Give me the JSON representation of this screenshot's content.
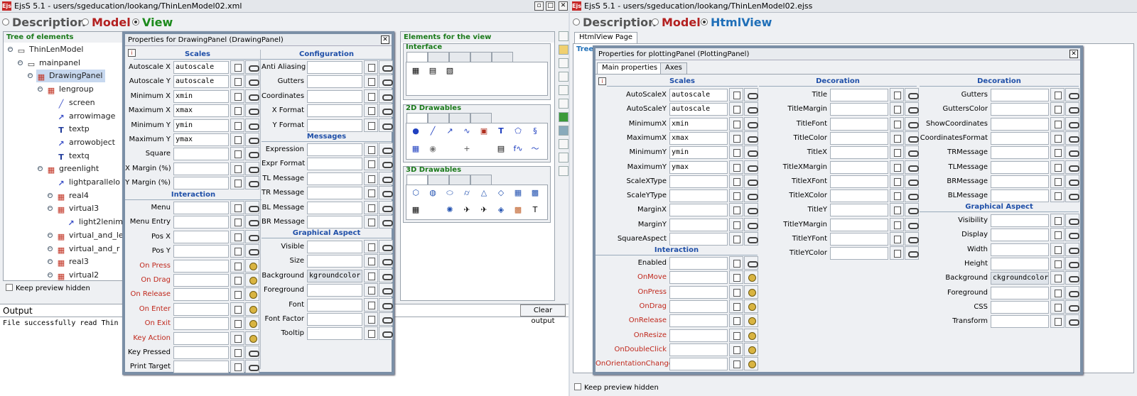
{
  "left_window": {
    "title": "EjsS 5.1 - users/sgeducation/lookang/ThinLenModel02.xml",
    "modes": [
      {
        "label": "Description",
        "color": "#555555",
        "selected": false
      },
      {
        "label": "Model",
        "color": "#b32020",
        "selected": false
      },
      {
        "label": "View",
        "color": "#1c8a1c",
        "selected": true
      }
    ],
    "tree_title": "Tree of elements",
    "tree": [
      {
        "label": "ThinLenModel",
        "icon": "frame"
      },
      {
        "label": "mainpanel",
        "icon": "panel"
      },
      {
        "label": "DrawingPanel",
        "icon": "chart",
        "selected": true
      },
      {
        "label": "lengroup",
        "icon": "chart"
      },
      {
        "label": "screen",
        "icon": "line"
      },
      {
        "label": "arrowimage",
        "icon": "arrow"
      },
      {
        "label": "textp",
        "icon": "text"
      },
      {
        "label": "arrowobject",
        "icon": "arrow"
      },
      {
        "label": "textq",
        "icon": "text"
      },
      {
        "label": "greenlight",
        "icon": "chart"
      },
      {
        "label": "lightparallelo",
        "icon": "arrow"
      },
      {
        "label": "real4",
        "icon": "chart"
      },
      {
        "label": "virtual3",
        "icon": "chart"
      },
      {
        "label": "light2lenim",
        "icon": "arrow"
      },
      {
        "label": "virtual_and_le",
        "icon": "chart"
      },
      {
        "label": "virtual_and_r",
        "icon": "chart"
      },
      {
        "label": "real3",
        "icon": "chart"
      },
      {
        "label": "virtual2",
        "icon": "chart"
      }
    ],
    "keep_preview": "Keep preview hidden",
    "output_title": "Output",
    "clear_output": "Clear output",
    "output_text": "File successfully read Thin",
    "elements_title": "Elements for the view",
    "interface_label": "Interface",
    "d2_label": "2D Drawables",
    "d3_label": "3D Drawables"
  },
  "drawing_dialog": {
    "title": "Properties for DrawingPanel (DrawingPanel)",
    "sections": {
      "scales": "Scales",
      "configuration": "Configuration",
      "interaction": "Interaction",
      "messages": "Messages",
      "graphical": "Graphical Aspect"
    },
    "left_rows": [
      {
        "label": "Autoscale X",
        "value": "autoscale",
        "red": false
      },
      {
        "label": "Autoscale Y",
        "value": "autoscale",
        "red": false
      },
      {
        "label": "Minimum X",
        "value": "xmin",
        "red": false
      },
      {
        "label": "Maximum X",
        "value": "xmax",
        "red": false
      },
      {
        "label": "Minimum Y",
        "value": "ymin",
        "red": false
      },
      {
        "label": "Maximum Y",
        "value": "ymax",
        "red": false
      },
      {
        "label": "Square",
        "value": "",
        "red": false
      },
      {
        "label": "X Margin (%)",
        "value": "",
        "red": false
      },
      {
        "label": "Y Margin (%)",
        "value": "",
        "red": false
      }
    ],
    "interaction_rows": [
      {
        "label": "Menu",
        "value": "",
        "red": false
      },
      {
        "label": "Menu Entry",
        "value": "",
        "red": false
      },
      {
        "label": "Pos X",
        "value": "",
        "red": false
      },
      {
        "label": "Pos Y",
        "value": "",
        "red": false
      },
      {
        "label": "On Press",
        "value": "",
        "red": true
      },
      {
        "label": "On Drag",
        "value": "",
        "red": true
      },
      {
        "label": "On Release",
        "value": "",
        "red": true
      },
      {
        "label": "On Enter",
        "value": "",
        "red": true
      },
      {
        "label": "On Exit",
        "value": "",
        "red": true
      },
      {
        "label": "Key Action",
        "value": "",
        "red": true
      },
      {
        "label": "Key Pressed",
        "value": "",
        "red": false
      },
      {
        "label": "Print Target",
        "value": "",
        "red": false
      }
    ],
    "config_rows": [
      {
        "label": "Anti Aliasing",
        "value": ""
      },
      {
        "label": "Gutters",
        "value": ""
      },
      {
        "label": "Coordinates",
        "value": ""
      },
      {
        "label": "X Format",
        "value": ""
      },
      {
        "label": "Y Format",
        "value": ""
      }
    ],
    "message_rows": [
      {
        "label": "Expression",
        "value": ""
      },
      {
        "label": "Expr Format",
        "value": ""
      },
      {
        "label": "TL Message",
        "value": ""
      },
      {
        "label": "TR Message",
        "value": ""
      },
      {
        "label": "BL Message",
        "value": ""
      },
      {
        "label": "BR Message",
        "value": ""
      }
    ],
    "graphic_rows": [
      {
        "label": "Visible",
        "value": ""
      },
      {
        "label": "Size",
        "value": ""
      },
      {
        "label": "Background",
        "value": "kgroundcolor"
      },
      {
        "label": "Foreground",
        "value": ""
      },
      {
        "label": "Font",
        "value": ""
      },
      {
        "label": "Font Factor",
        "value": ""
      },
      {
        "label": "Tooltip",
        "value": ""
      }
    ]
  },
  "right_window": {
    "title": "EjsS 5.1 - users/sgeducation/lookang/ThinLenModel02.ejss",
    "modes": [
      {
        "label": "Description",
        "color": "#555555",
        "selected": false
      },
      {
        "label": "Model",
        "color": "#b32020",
        "selected": false
      },
      {
        "label": "HtmlView",
        "color": "#1f6fb8",
        "selected": true
      }
    ],
    "page_tab": "HtmlView Page",
    "tree_title_stub": "Tree",
    "keep_preview": "Keep preview hidden"
  },
  "plotting_dialog": {
    "title": "Properties for plottingPanel (PlottingPanel)",
    "tabs": [
      "Main properties",
      "Axes"
    ],
    "sections": {
      "scales": "Scales",
      "decoration1": "Decoration",
      "decoration2": "Decoration",
      "interaction": "Interaction",
      "graphical": "Graphical Aspect"
    },
    "scales_rows": [
      {
        "label": "AutoScaleX",
        "value": "autoscale"
      },
      {
        "label": "AutoScaleY",
        "value": "autoscale"
      },
      {
        "label": "MinimumX",
        "value": "xmin"
      },
      {
        "label": "MaximumX",
        "value": "xmax"
      },
      {
        "label": "MinimumY",
        "value": "ymin"
      },
      {
        "label": "MaximumY",
        "value": "ymax"
      },
      {
        "label": "ScaleXType",
        "value": ""
      },
      {
        "label": "ScaleYType",
        "value": ""
      },
      {
        "label": "MarginX",
        "value": ""
      },
      {
        "label": "MarginY",
        "value": ""
      },
      {
        "label": "SquareAspect",
        "value": ""
      }
    ],
    "interaction_rows": [
      {
        "label": "Enabled",
        "value": "",
        "red": false
      },
      {
        "label": "OnMove",
        "value": "",
        "red": true
      },
      {
        "label": "OnPress",
        "value": "",
        "red": true
      },
      {
        "label": "OnDrag",
        "value": "",
        "red": true
      },
      {
        "label": "OnRelease",
        "value": "",
        "red": true
      },
      {
        "label": "OnResize",
        "value": "",
        "red": true
      },
      {
        "label": "OnDoubleClick",
        "value": "",
        "red": true
      },
      {
        "label": "OnOrientationChange",
        "value": "",
        "red": true
      }
    ],
    "decoration1_rows": [
      {
        "label": "Title",
        "value": ""
      },
      {
        "label": "TitleMargin",
        "value": ""
      },
      {
        "label": "TitleFont",
        "value": ""
      },
      {
        "label": "TitleColor",
        "value": ""
      },
      {
        "label": "TitleX",
        "value": ""
      },
      {
        "label": "TitleXMargin",
        "value": ""
      },
      {
        "label": "TitleXFont",
        "value": ""
      },
      {
        "label": "TitleXColor",
        "value": ""
      },
      {
        "label": "TitleY",
        "value": ""
      },
      {
        "label": "TitleYMargin",
        "value": ""
      },
      {
        "label": "TitleYFont",
        "value": ""
      },
      {
        "label": "TitleYColor",
        "value": ""
      }
    ],
    "decoration2_rows": [
      {
        "label": "Gutters",
        "value": ""
      },
      {
        "label": "GuttersColor",
        "value": ""
      },
      {
        "label": "ShowCoordinates",
        "value": ""
      },
      {
        "label": "CoordinatesFormat",
        "value": ""
      },
      {
        "label": "TRMessage",
        "value": ""
      },
      {
        "label": "TLMessage",
        "value": ""
      },
      {
        "label": "BRMessage",
        "value": ""
      },
      {
        "label": "BLMessage",
        "value": ""
      }
    ],
    "graphical_rows": [
      {
        "label": "Visibility",
        "value": ""
      },
      {
        "label": "Display",
        "value": ""
      },
      {
        "label": "Width",
        "value": ""
      },
      {
        "label": "Height",
        "value": ""
      },
      {
        "label": "Background",
        "value": "ckgroundcolor"
      },
      {
        "label": "Foreground",
        "value": ""
      },
      {
        "label": "CSS",
        "value": ""
      },
      {
        "label": "Transform",
        "value": ""
      }
    ]
  }
}
